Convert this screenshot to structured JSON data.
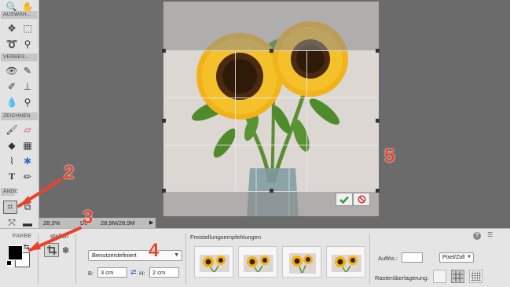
{
  "toolbox": {
    "sections": [
      "AUSWÄH...",
      "VERBES...",
      "ZEICHNEN",
      "ÄNDE"
    ],
    "colors_label": "FARBE"
  },
  "canvas": {
    "crop_confirm_icon": "check-icon",
    "crop_cancel_icon": "cancel-icon"
  },
  "statusbar": {
    "zoom": "28,3%",
    "doc_prefix": "Do",
    "doc_size": "28,9M/28,9M"
  },
  "options": {
    "tool_title": "stellen",
    "preset_value": "Benutzerdefiniert",
    "width_label": "B:",
    "width_value": "3 cm",
    "height_label": "H:",
    "height_value": "2 cm",
    "suggestions_label": "Freistellungsempfehlungen",
    "resolution_label": "Auflös.:",
    "resolution_value": "",
    "unit_value": "Pixel/Zoll",
    "overlay_label": "Rasterüberlagerung:",
    "help_icon": "?"
  },
  "annotations": [
    "2",
    "3",
    "4",
    "5"
  ],
  "colors": {
    "annotation": "#e8432c",
    "confirm": "#2e9b2e",
    "cancel": "#d23c3c",
    "foreground": "#000000",
    "background": "#ffffff"
  }
}
